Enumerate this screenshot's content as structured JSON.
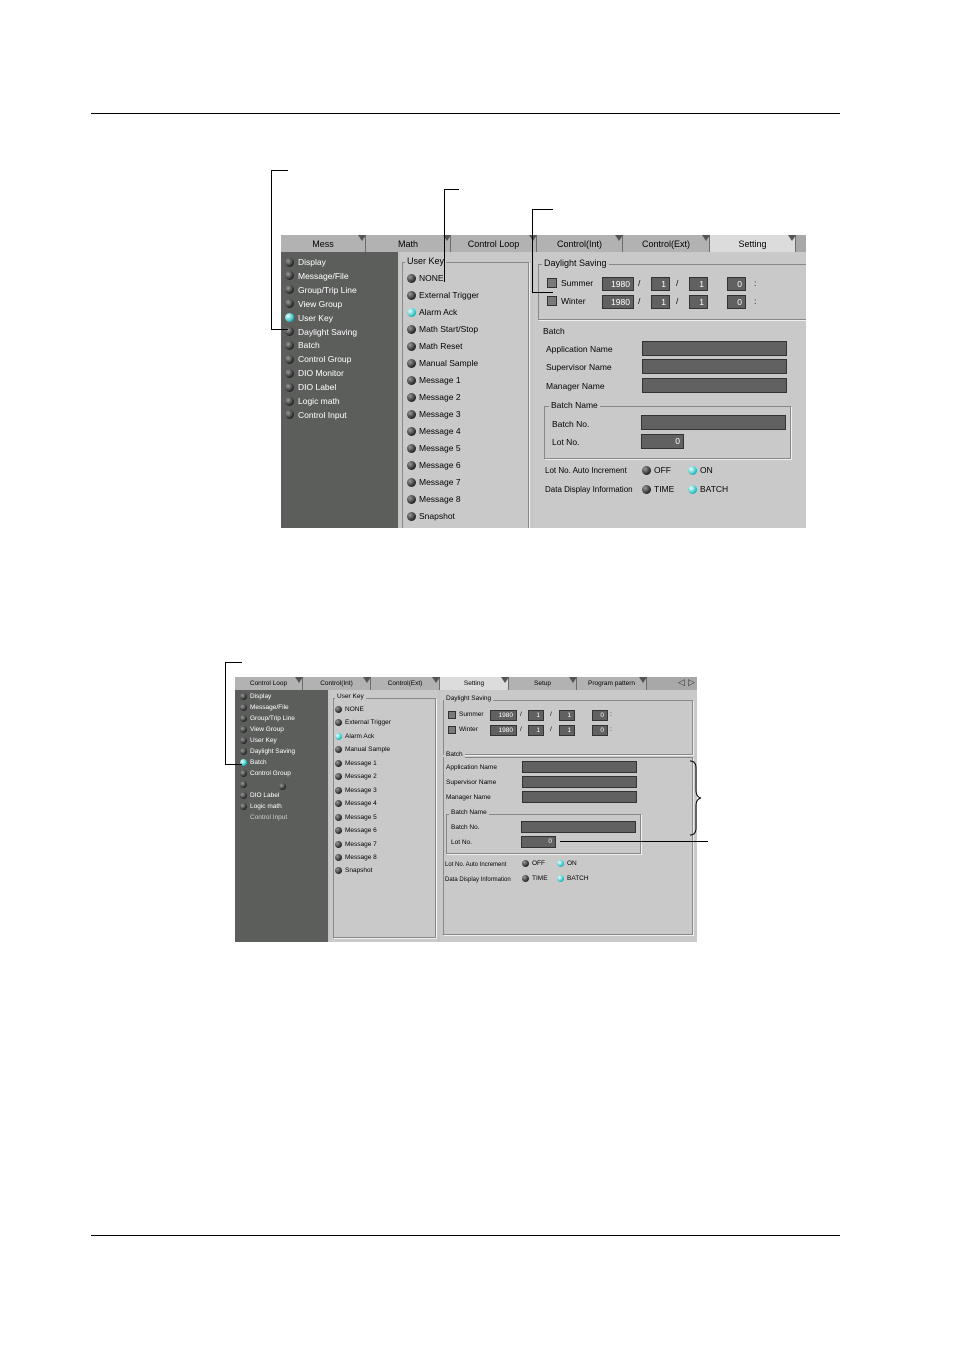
{
  "screen1": {
    "tabs": [
      "Mess",
      "Math",
      "Control Loop",
      "Control(Int)",
      "Control(Ext)",
      "Setting"
    ],
    "active_tab": "Setting",
    "menu": [
      {
        "label": "Display",
        "on": false
      },
      {
        "label": "Message/File",
        "on": false
      },
      {
        "label": "Group/Trip Line",
        "on": false
      },
      {
        "label": "View Group",
        "on": false
      },
      {
        "label": "User Key",
        "on": true
      },
      {
        "label": "Daylight Saving",
        "on": false
      },
      {
        "label": "Batch",
        "on": false
      },
      {
        "label": "Control Group",
        "on": false
      },
      {
        "label": "DIO Monitor",
        "on": false
      },
      {
        "label": "DIO Label",
        "on": false
      },
      {
        "label": "Logic math",
        "on": false
      },
      {
        "label": "Control Input",
        "on": false
      }
    ],
    "user_key": {
      "title": "User Key",
      "options": [
        {
          "label": "NONE",
          "on": false
        },
        {
          "label": "External Trigger",
          "on": false
        },
        {
          "label": "Alarm Ack",
          "on": true
        },
        {
          "label": "Math Start/Stop",
          "on": false
        },
        {
          "label": "Math Reset",
          "on": false
        },
        {
          "label": "Manual Sample",
          "on": false
        },
        {
          "label": "Message 1",
          "on": false
        },
        {
          "label": "Message 2",
          "on": false
        },
        {
          "label": "Message 3",
          "on": false
        },
        {
          "label": "Message 4",
          "on": false
        },
        {
          "label": "Message 5",
          "on": false
        },
        {
          "label": "Message 6",
          "on": false
        },
        {
          "label": "Message 7",
          "on": false
        },
        {
          "label": "Message 8",
          "on": false
        },
        {
          "label": "Snapshot",
          "on": false
        }
      ]
    },
    "daylight": {
      "title": "Daylight Saving",
      "rows": [
        {
          "label": "Summer",
          "year": "1980",
          "month": "1",
          "day": "1",
          "hour": "0"
        },
        {
          "label": "Winter",
          "year": "1980",
          "month": "1",
          "day": "1",
          "hour": "0"
        }
      ],
      "date_sep": "/",
      "time_sep": ":"
    },
    "batch": {
      "title": "Batch",
      "fields": [
        "Application Name",
        "Supervisor Name",
        "Manager Name"
      ],
      "batch_name_title": "Batch Name",
      "batch_no_label": "Batch No.",
      "lot_no_label": "Lot No.",
      "lot_no_value": "0",
      "auto_increment_label": "Lot No. Auto Increment",
      "auto_increment_options": [
        {
          "label": "OFF",
          "on": false
        },
        {
          "label": "ON",
          "on": true
        }
      ],
      "display_info_label": "Data Display Information",
      "display_info_options": [
        {
          "label": "TIME",
          "on": false
        },
        {
          "label": "BATCH",
          "on": true
        }
      ]
    }
  },
  "screen2": {
    "tabs": [
      "Control Loop",
      "Control(Int)",
      "Control(Ext)",
      "Setting",
      "Setup",
      "Program pattern"
    ],
    "active_tab": "Setting",
    "scroll_arrows": [
      "◁",
      "▷"
    ],
    "menu": [
      {
        "label": "Display",
        "on": false
      },
      {
        "label": "Message/File",
        "on": false
      },
      {
        "label": "Group/Trip Line",
        "on": false
      },
      {
        "label": "View Group",
        "on": false
      },
      {
        "label": "User Key",
        "on": false
      },
      {
        "label": "Daylight Saving",
        "on": false
      },
      {
        "label": "Batch",
        "on": true
      },
      {
        "label": "Control Group",
        "on": false
      },
      {
        "label": "",
        "on": false
      },
      {
        "label": "DIO Label",
        "on": false
      },
      {
        "label": "Logic math",
        "on": false
      },
      {
        "label": "Control Input",
        "on": null
      }
    ],
    "user_key": {
      "title": "User Key",
      "options": [
        {
          "label": "NONE",
          "on": false
        },
        {
          "label": "External Trigger",
          "on": false
        },
        {
          "label": "Alarm Ack",
          "on": true
        },
        {
          "label": "Manual Sample",
          "on": false
        },
        {
          "label": "Message 1",
          "on": false
        },
        {
          "label": "Message 2",
          "on": false
        },
        {
          "label": "Message 3",
          "on": false
        },
        {
          "label": "Message 4",
          "on": false
        },
        {
          "label": "Message 5",
          "on": false
        },
        {
          "label": "Message 6",
          "on": false
        },
        {
          "label": "Message 7",
          "on": false
        },
        {
          "label": "Message 8",
          "on": false
        },
        {
          "label": "Snapshot",
          "on": false
        }
      ]
    },
    "daylight": {
      "title": "Daylight Saving",
      "rows": [
        {
          "label": "Summer",
          "year": "1980",
          "month": "1",
          "day": "1",
          "hour": "0"
        },
        {
          "label": "Winter",
          "year": "1980",
          "month": "1",
          "day": "1",
          "hour": "0"
        }
      ],
      "date_sep": "/",
      "time_sep": ":"
    },
    "batch": {
      "title": "Batch",
      "fields": [
        "Application Name",
        "Supervisor Name",
        "Manager Name"
      ],
      "batch_name_title": "Batch Name",
      "batch_no_label": "Batch No.",
      "lot_no_label": "Lot No.",
      "lot_no_value": "0",
      "auto_increment_label": "Lot No. Auto Increment",
      "auto_increment_options": [
        {
          "label": "OFF",
          "on": false
        },
        {
          "label": "ON",
          "on": true
        }
      ],
      "display_info_label": "Data Display Information",
      "display_info_options": [
        {
          "label": "TIME",
          "on": false
        },
        {
          "label": "BATCH",
          "on": true
        }
      ]
    }
  }
}
